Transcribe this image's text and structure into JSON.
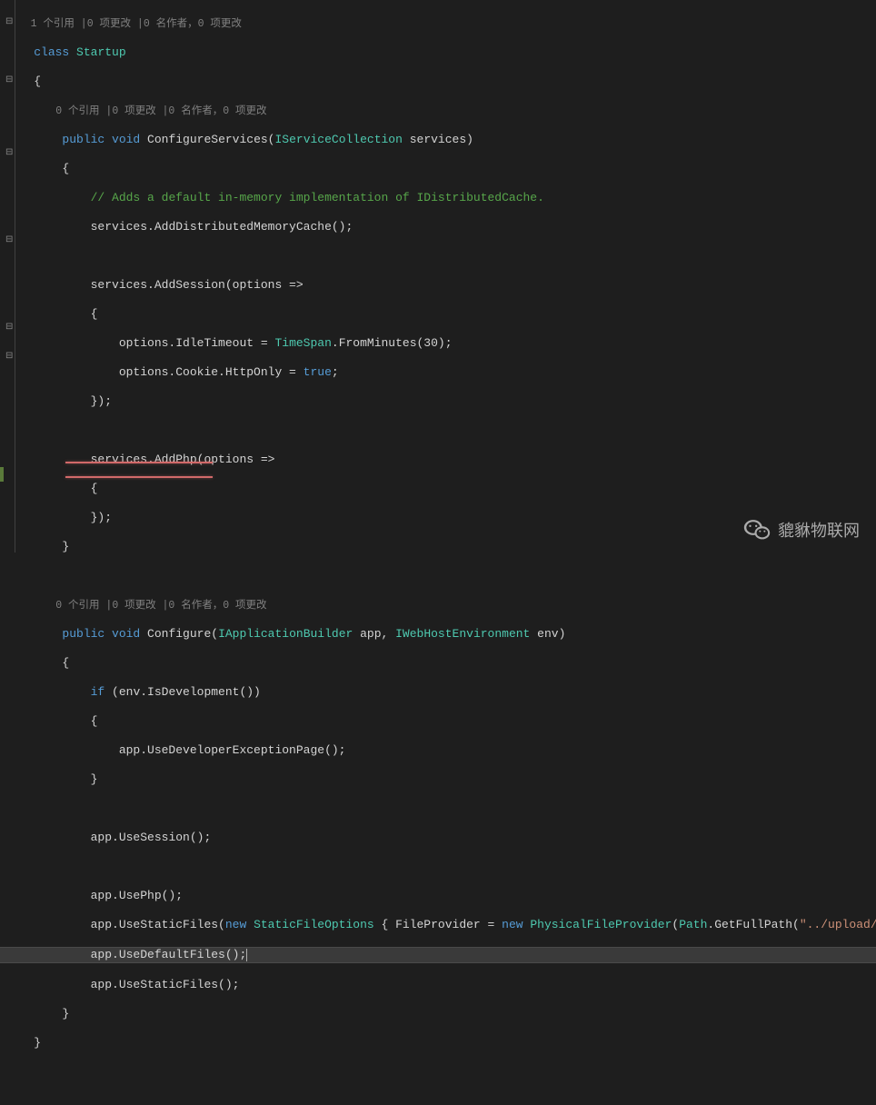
{
  "codelens": {
    "class": "1 个引用 |0 项更改 |0 名作者，0 项更改",
    "method1": "0 个引用 |0 项更改 |0 名作者，0 项更改",
    "method2": "0 个引用 |0 项更改 |0 名作者，0 项更改"
  },
  "code": {
    "l1": "class",
    "l1b": " Startup",
    "l2": "{",
    "l4": "public void",
    "l4b": " ConfigureServices(",
    "l4c": "IServiceCollection",
    "l4d": " services)",
    "l5": "{",
    "l6": "// Adds a default in-memory implementation of IDistributedCache.",
    "l7": "services.AddDistributedMemoryCache();",
    "l9": "services.AddSession(options =>",
    "l10": "{",
    "l11a": "options.IdleTimeout = ",
    "l11b": "TimeSpan",
    "l11c": ".FromMinutes(30);",
    "l12a": "options.Cookie.HttpOnly = ",
    "l12b": "true",
    "l12c": ";",
    "l13": "});",
    "l15": "services.AddPhp(options =>",
    "l16": "{",
    "l17": "});",
    "l18": "}",
    "l20": "public void",
    "l20b": " Configure(",
    "l20c": "IApplicationBuilder",
    "l20d": " app, ",
    "l20e": "IWebHostEnvironment",
    "l20f": " env)",
    "l21": "{",
    "l22a": "if",
    "l22b": " (env.IsDevelopment())",
    "l23": "{",
    "l24": "app.UseDeveloperExceptionPage();",
    "l25": "}",
    "l27": "app.UseSession();",
    "l29": "app.UsePhp();",
    "l30a": "app.UseStaticFiles(",
    "l30b": "new",
    "l30c": " StaticFileOptions",
    "l30d": " { FileProvider = ",
    "l30e": "new",
    "l30f": " PhysicalFileProvider",
    "l30g": "(",
    "l30h": "Path",
    "l30i": ".GetFullPath(",
    "l30j": "\"../upload/\"",
    "l30k": ")) });",
    "l31": "app.UseDefaultFiles();",
    "l32": "app.UseStaticFiles();",
    "l33": "}",
    "l34": "}"
  },
  "watermark": "貔貅物联网"
}
